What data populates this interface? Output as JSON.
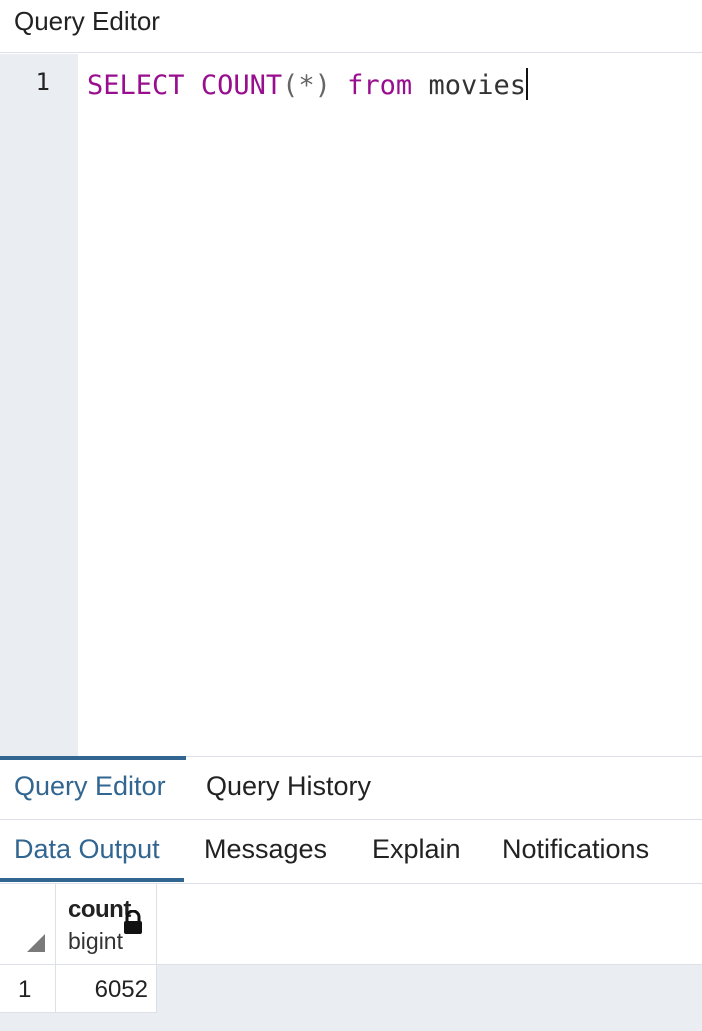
{
  "header": {
    "title": "Query Editor"
  },
  "editor": {
    "line_number": "1",
    "tokens": {
      "select": "SELECT",
      "count": "COUNT",
      "paren_star": "(*)",
      "from": "from",
      "table": "movies"
    }
  },
  "tabs": {
    "top": [
      {
        "label": "Query Editor",
        "active": true
      },
      {
        "label": "Query History",
        "active": false
      }
    ],
    "output": [
      {
        "label": "Data Output",
        "active": true
      },
      {
        "label": "Messages",
        "active": false
      },
      {
        "label": "Explain",
        "active": false
      },
      {
        "label": "Notifications",
        "active": false
      }
    ]
  },
  "grid": {
    "columns": [
      {
        "name": "count",
        "type": "bigint",
        "icon": "lock-icon"
      }
    ],
    "rows": [
      {
        "num": "1",
        "values": [
          "6052"
        ]
      }
    ]
  },
  "colors": {
    "accent": "#326690",
    "keyword": "#990d8f",
    "gutter": "#eaeef3"
  }
}
